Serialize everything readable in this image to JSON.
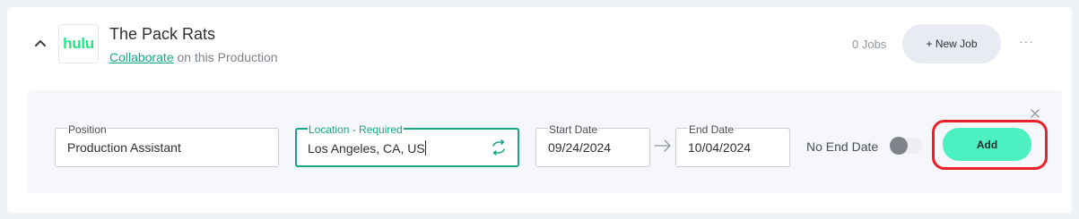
{
  "production": {
    "title": "The Pack Rats",
    "logo_text": "hulu",
    "collaborate_link": "Collaborate",
    "subtitle_rest": " on this Production",
    "jobs_count": "0 Jobs",
    "new_job_label": "+ New Job",
    "more_label": "···"
  },
  "form": {
    "position": {
      "label": "Position",
      "value": "Production Assistant"
    },
    "location": {
      "label": "Location - Required",
      "value": "Los Angeles, CA, US"
    },
    "start_date": {
      "label": "Start Date",
      "value": "09/24/2024"
    },
    "end_date": {
      "label": "End Date",
      "value": "10/04/2024"
    },
    "no_end_date_label": "No End Date",
    "no_end_date_enabled": false,
    "add_label": "Add"
  },
  "colors": {
    "accent": "#1aa58a",
    "add_button": "#4df0c0",
    "highlight": "#e8202a",
    "hulu_brand": "#1ce783"
  }
}
